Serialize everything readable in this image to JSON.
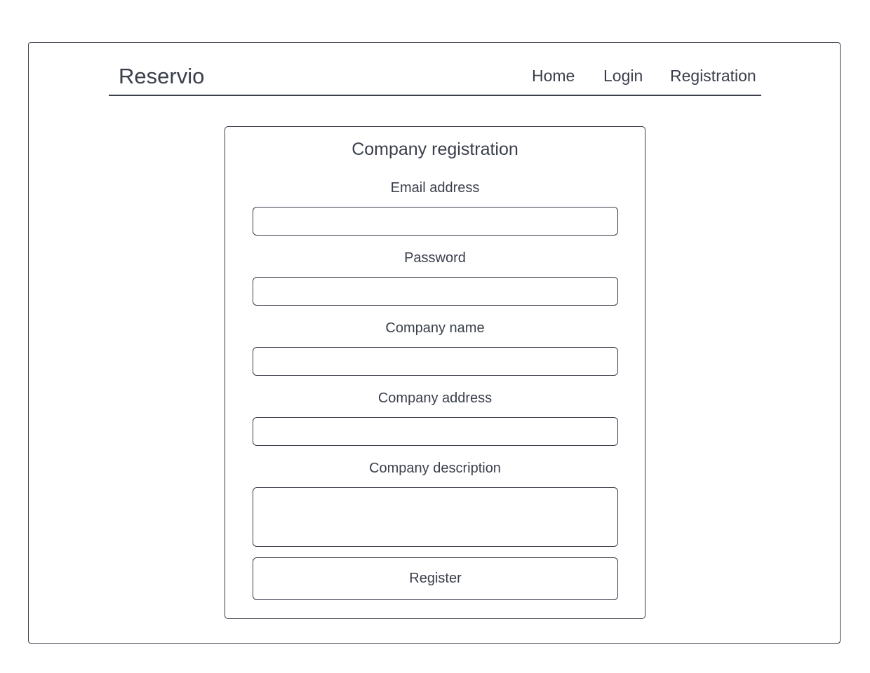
{
  "header": {
    "brand": "Reservio",
    "nav": {
      "home": "Home",
      "login": "Login",
      "registration": "Registration"
    }
  },
  "form": {
    "title": "Company registration",
    "fields": {
      "email": {
        "label": "Email address",
        "value": ""
      },
      "password": {
        "label": "Password",
        "value": ""
      },
      "company_name": {
        "label": "Company name",
        "value": ""
      },
      "company_address": {
        "label": "Company address",
        "value": ""
      },
      "company_description": {
        "label": "Company description",
        "value": ""
      }
    },
    "submit_label": "Register"
  }
}
